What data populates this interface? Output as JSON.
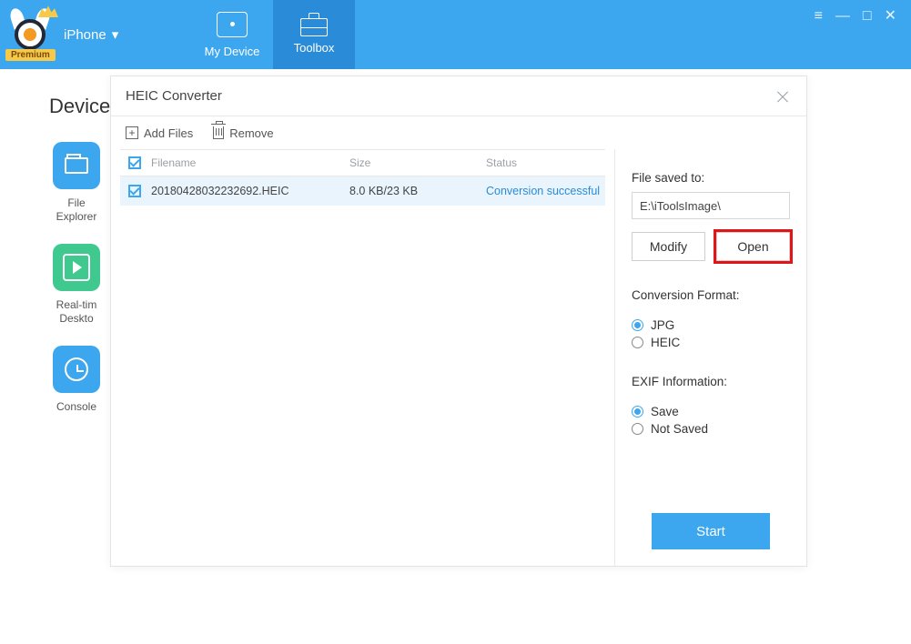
{
  "header": {
    "premium_label": "Premium",
    "device_label": "iPhone",
    "tabs": {
      "my_device": "My Device",
      "toolbox": "Toolbox"
    }
  },
  "background": {
    "title": "Device",
    "items": {
      "file_explorer": "File\nExplorer",
      "realtime_desktop": "Real-tim\nDeskto",
      "console": "Console"
    }
  },
  "dialog": {
    "title": "HEIC Converter",
    "toolbar": {
      "add_files": "Add Files",
      "remove": "Remove"
    },
    "columns": {
      "filename": "Filename",
      "size": "Size",
      "status": "Status"
    },
    "rows": [
      {
        "filename": "20180428032232692.HEIC",
        "size": "8.0 KB/23 KB",
        "status": "Conversion successful",
        "checked": true
      }
    ],
    "saved_to": {
      "label": "File saved to:",
      "path": "E:\\iToolsImage\\",
      "modify": "Modify",
      "open": "Open"
    },
    "format": {
      "label": "Conversion Format:",
      "jpg": "JPG",
      "heic": "HEIC",
      "selected": "jpg"
    },
    "exif": {
      "label": "EXIF Information:",
      "save": "Save",
      "not_saved": "Not Saved",
      "selected": "save"
    },
    "start": "Start"
  }
}
